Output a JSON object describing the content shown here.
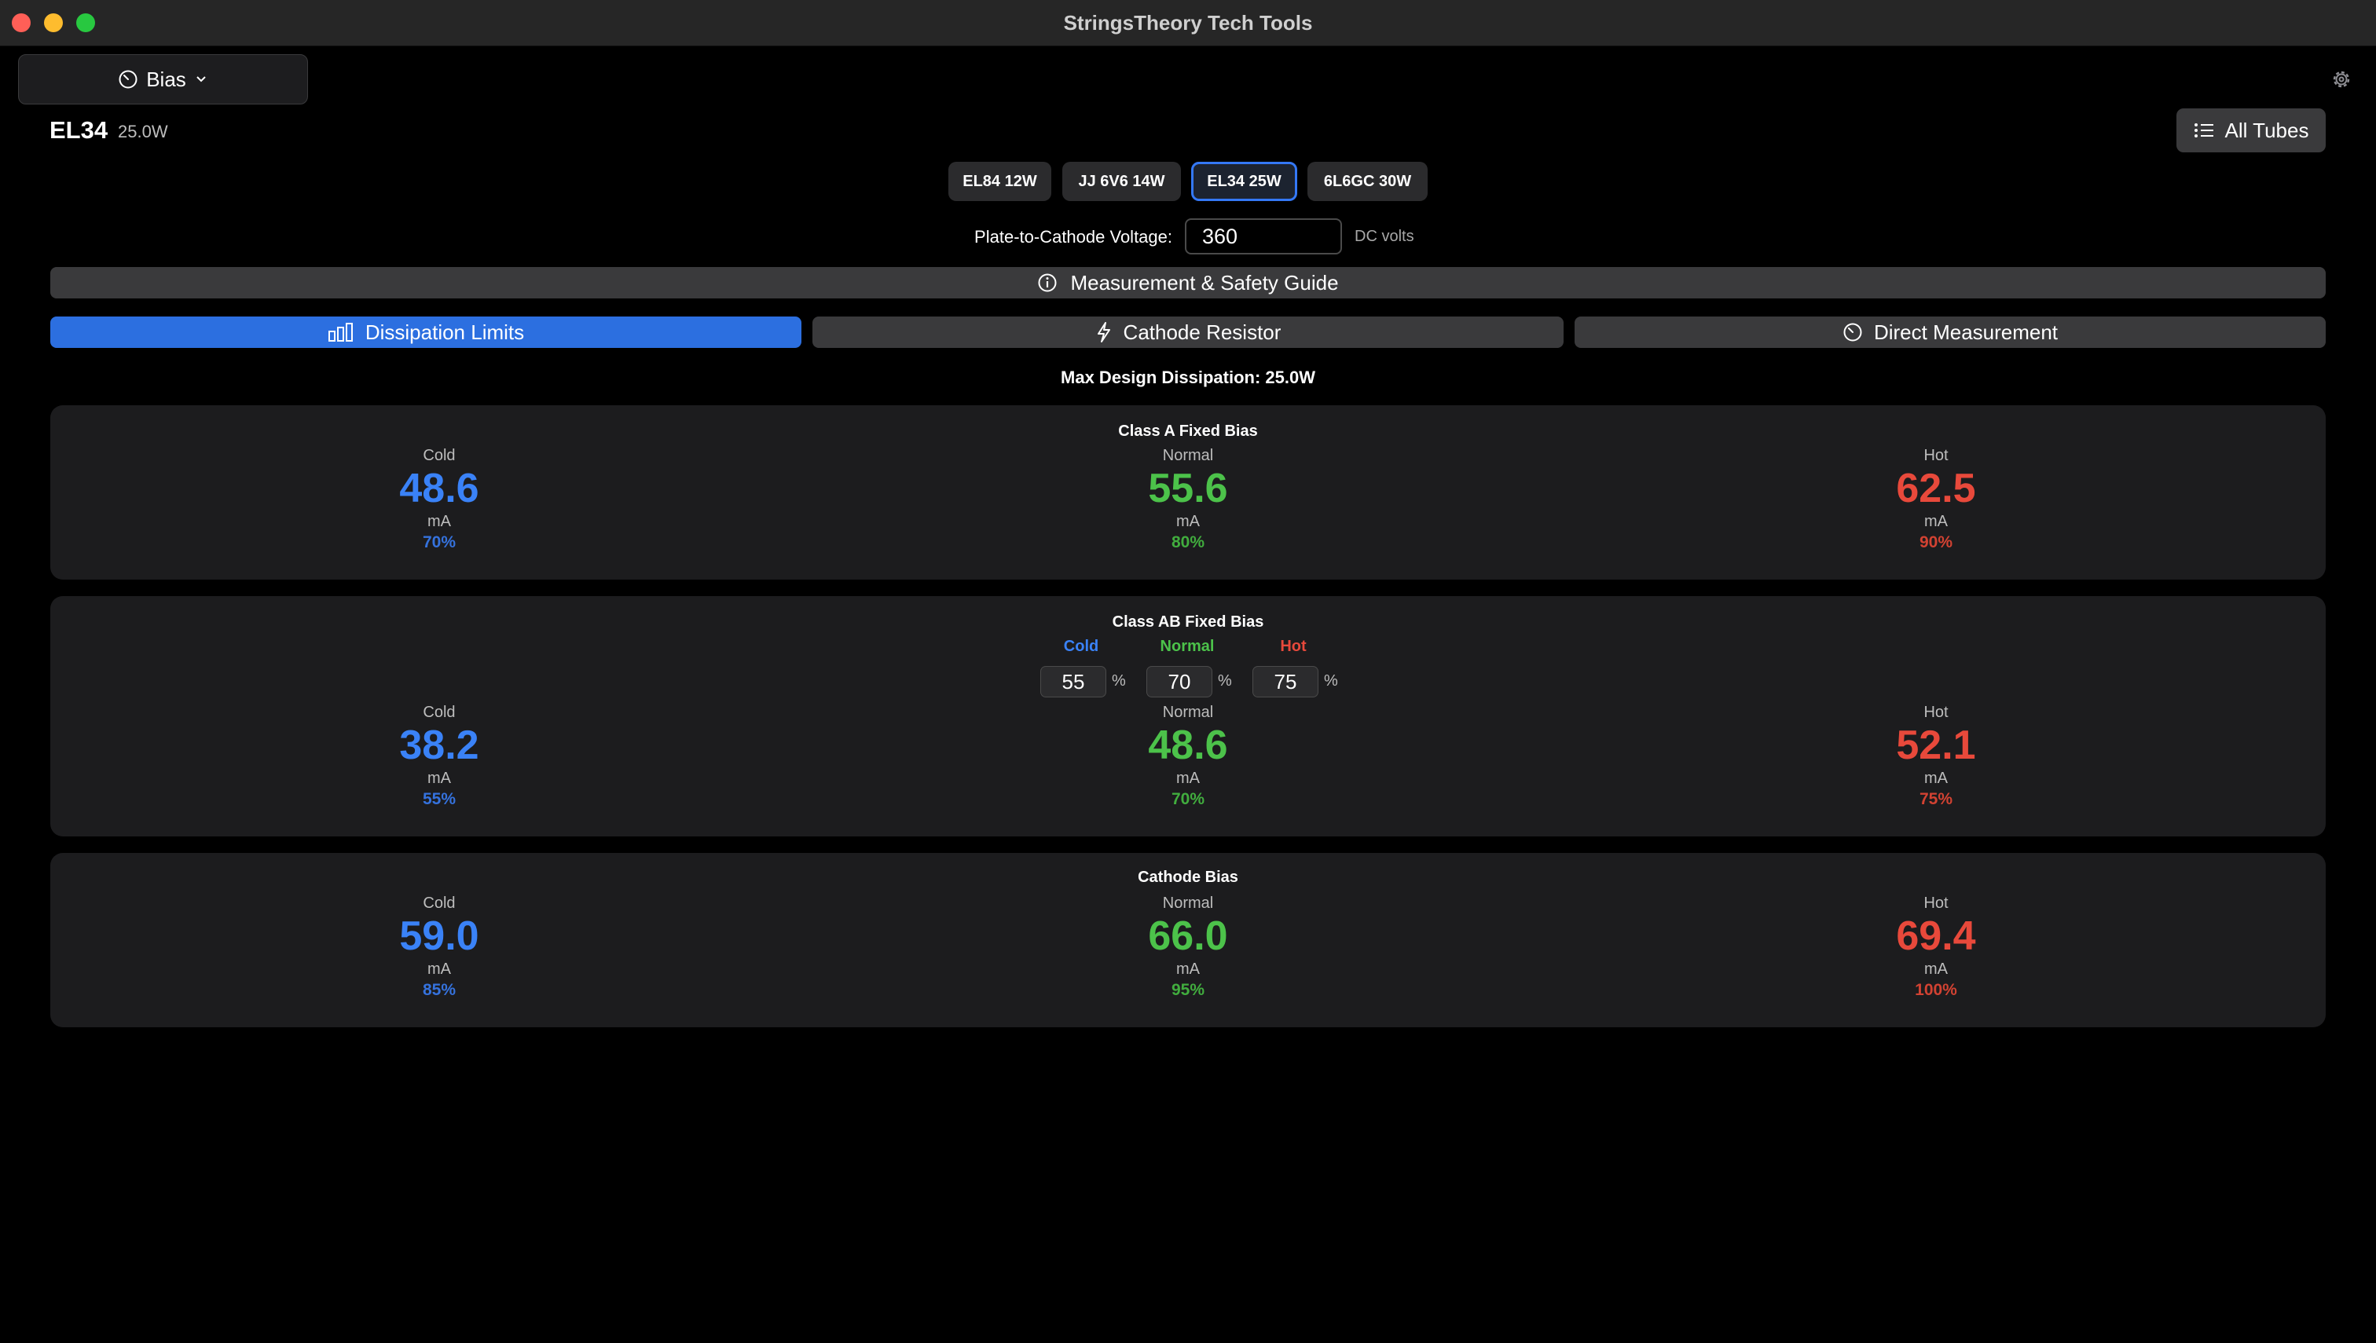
{
  "window": {
    "title": "StringsTheory Tech Tools"
  },
  "toolbar": {
    "mode_label": "Bias",
    "all_tubes_label": "All Tubes"
  },
  "tube": {
    "name": "EL34",
    "watts": "25.0W"
  },
  "tube_chips": [
    {
      "label": "EL84 12W",
      "selected": false
    },
    {
      "label": "JJ 6V6 14W",
      "selected": false
    },
    {
      "label": "EL34 25W",
      "selected": true
    },
    {
      "label": "6L6GC 30W",
      "selected": false
    }
  ],
  "voltage": {
    "label": "Plate-to-Cathode Voltage:",
    "value": "360",
    "unit": "DC volts"
  },
  "guide_label": "Measurement & Safety Guide",
  "segments": [
    {
      "label": "Dissipation Limits",
      "active": true
    },
    {
      "label": "Cathode Resistor",
      "active": false
    },
    {
      "label": "Direct Measurement",
      "active": false
    }
  ],
  "max_dissipation": "Max Design Dissipation: 25.0W",
  "colors": {
    "cold": "#3a82f7",
    "normal": "#4cc24a",
    "hot": "#e8493b",
    "accent": "#2c6fe0"
  },
  "cards": [
    {
      "title": "Class A Fixed Bias",
      "cold": {
        "label": "Cold",
        "value": "48.6",
        "unit": "mA",
        "percent": "70%"
      },
      "normal": {
        "label": "Normal",
        "value": "55.6",
        "unit": "mA",
        "percent": "80%"
      },
      "hot": {
        "label": "Hot",
        "value": "62.5",
        "unit": "mA",
        "percent": "90%"
      }
    },
    {
      "title": "Class AB Fixed Bias",
      "pct_inputs": {
        "cold_label": "Cold",
        "cold_value": "55",
        "normal_label": "Normal",
        "normal_value": "70",
        "hot_label": "Hot",
        "hot_value": "75",
        "unit": "%"
      },
      "cold": {
        "label": "Cold",
        "value": "38.2",
        "unit": "mA",
        "percent": "55%"
      },
      "normal": {
        "label": "Normal",
        "value": "48.6",
        "unit": "mA",
        "percent": "70%"
      },
      "hot": {
        "label": "Hot",
        "value": "52.1",
        "unit": "mA",
        "percent": "75%"
      }
    },
    {
      "title": "Cathode Bias",
      "cold": {
        "label": "Cold",
        "value": "59.0",
        "unit": "mA",
        "percent": "85%"
      },
      "normal": {
        "label": "Normal",
        "value": "66.0",
        "unit": "mA",
        "percent": "95%"
      },
      "hot": {
        "label": "Hot",
        "value": "69.4",
        "unit": "mA",
        "percent": "100%"
      }
    }
  ]
}
